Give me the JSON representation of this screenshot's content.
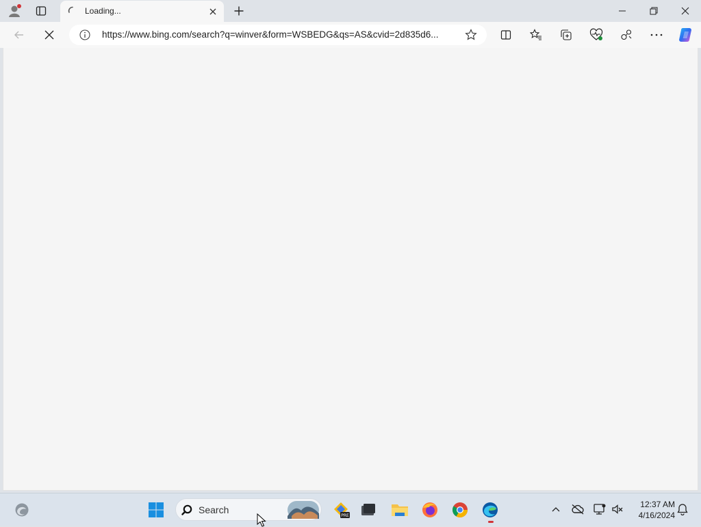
{
  "browser": {
    "tab": {
      "title": "Loading..."
    },
    "address_bar": {
      "url": "https://www.bing.com/search?q=winver&form=WSBEDG&qs=AS&cvid=2d835d6..."
    }
  },
  "taskbar": {
    "search_label": "Search",
    "clock": {
      "time": "12:37 AM",
      "date": "4/16/2024"
    },
    "pinned_apps": [
      "edge-copilot",
      "start",
      "search",
      "microsoft-store-preview",
      "terminal",
      "file-explorer",
      "firefox",
      "chrome",
      "edge"
    ]
  },
  "colors": {
    "accent_edge_blue": "#0c59a4",
    "notification_red": "#d13438",
    "content_background": "#f5f5f5"
  }
}
